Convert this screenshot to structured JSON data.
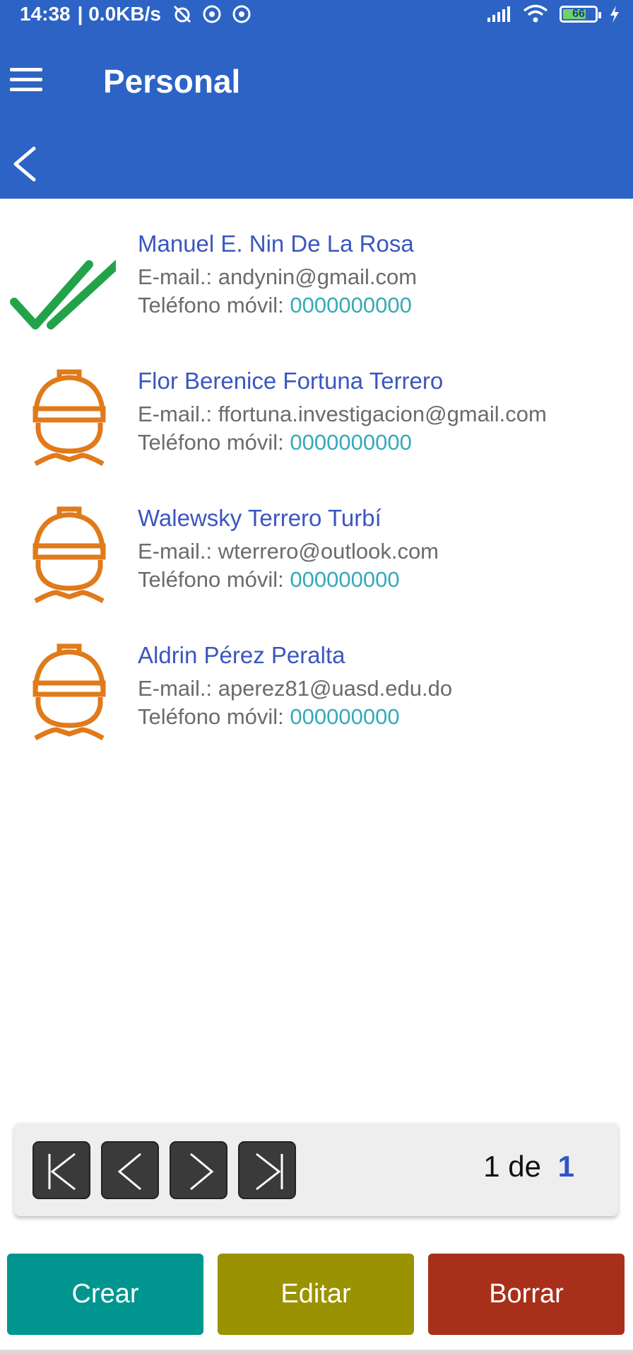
{
  "status_bar": {
    "time": "14:38",
    "speed": "| 0.0KB/s",
    "battery_level": "66"
  },
  "appbar": {
    "title": "Personal"
  },
  "contacts": [
    {
      "name": "Manuel E. Nin De La Rosa",
      "email_label": "E-mail.:",
      "email": "andynin@gmail.com",
      "phone_label": "Teléfono móvil:",
      "phone": "0000000000",
      "icon": "double-check-icon"
    },
    {
      "name": "Flor Berenice Fortuna Terrero",
      "email_label": "E-mail.:",
      "email": "ffortuna.investigacion@gmail.com",
      "phone_label": "Teléfono móvil:",
      "phone": "0000000000",
      "icon": "worker-helmet-icon"
    },
    {
      "name": "Walewsky Terrero Turbí",
      "email_label": "E-mail.:",
      "email": "wterrero@outlook.com",
      "phone_label": "Teléfono móvil:",
      "phone": "000000000",
      "icon": "worker-helmet-icon"
    },
    {
      "name": "Aldrin Pérez Peralta",
      "email_label": "E-mail.:",
      "email": "aperez81@uasd.edu.do",
      "phone_label": "Teléfono móvil:",
      "phone": "000000000",
      "icon": "worker-helmet-icon"
    }
  ],
  "pager": {
    "current": "1",
    "separator": "de",
    "total": "1"
  },
  "actions": {
    "create": "Crear",
    "edit": "Editar",
    "delete": "Borrar"
  },
  "colors": {
    "appbar": "#2c63c5",
    "name": "#3b56c0",
    "phone_number": "#33aab8",
    "create": "#00968f",
    "edit": "#9a9200",
    "delete": "#a8301a",
    "helmet": "#e07a1a",
    "check": "#22a34a"
  }
}
